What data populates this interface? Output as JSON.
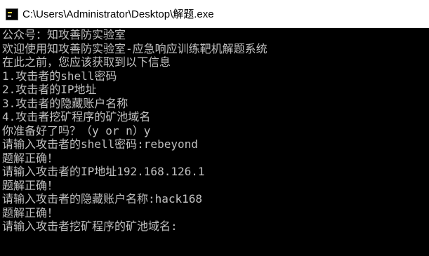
{
  "window": {
    "title": "C:\\Users\\Administrator\\Desktop\\解题.exe",
    "icon": "console-app-icon",
    "colors": {
      "titlebar_bg": "#ffffff",
      "console_bg": "#000000",
      "console_text": "#c0c0c0"
    }
  },
  "console": {
    "lines": [
      "公众号：知攻善防实验室",
      "欢迎使用知攻善防实验室-应急响应训练靶机解题系统",
      "在此之前，您应该获取到以下信息",
      "1.攻击者的shell密码",
      "2.攻击者的IP地址",
      "3.攻击者的隐藏账户名称",
      "4.攻击者挖矿程序的矿池域名",
      "你准备好了吗？（y or n）y",
      "请输入攻击者的shell密码:rebeyond",
      "题解正确！",
      "请输入攻击者的IP地址192.168.126.1",
      "题解正确！",
      "请输入攻击者的隐藏账户名称:hack168",
      "题解正确！",
      "请输入攻击者挖矿程序的矿池域名:"
    ]
  }
}
